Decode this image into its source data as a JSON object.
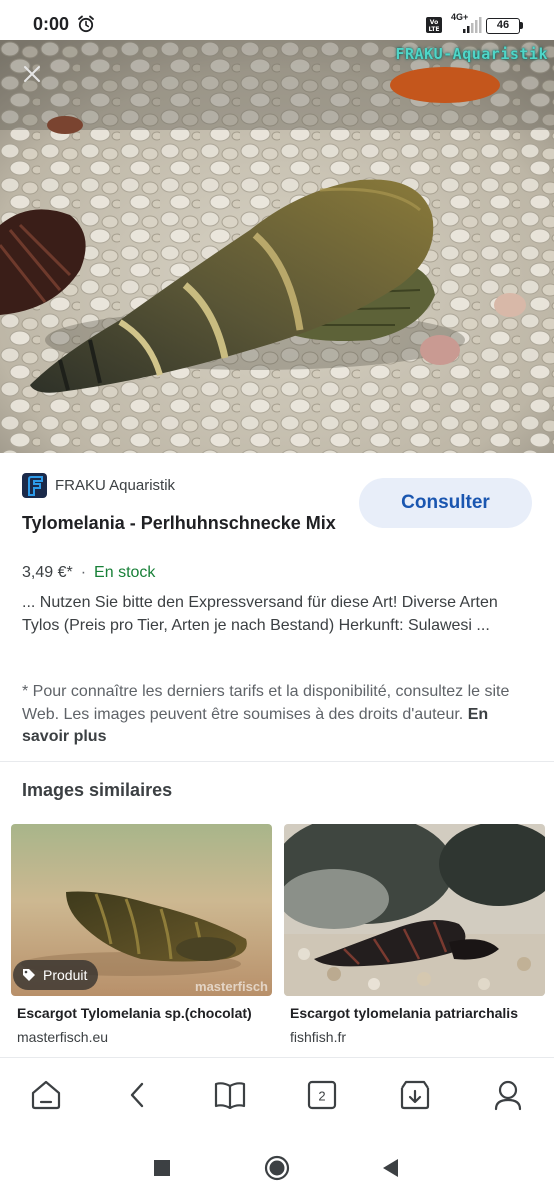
{
  "status_bar": {
    "time": "0:00",
    "network": "4G+",
    "volte": "VoLTE",
    "battery": "46",
    "icons": [
      "alarm-icon",
      "volte-icon",
      "signal-icon",
      "battery-icon"
    ]
  },
  "hero": {
    "watermark": "FRAKU-Aquaristik",
    "close_icon": "close-icon"
  },
  "result": {
    "source_name": "FRAKU Aquaristik",
    "visit_label": "Consulter",
    "title": "Tylomelania - Perlhuhnschnecke Mix",
    "price": "3,49 €*",
    "separator": "·",
    "stock": "En stock",
    "description": "... Nutzen Sie bitte den Expressversand für diese Art! Diverse Arten Tylos (Preis pro Tier, Arten je nach Bestand) Herkunft: Sulawesi ...",
    "disclaimer": "* Pour connaître les derniers tarifs et la disponibilité, consultez le site Web. Les images peuvent être soumises à des droits d'auteur.",
    "learn_more": "En savoir plus"
  },
  "similar": {
    "heading": "Images similaires",
    "items": [
      {
        "badge": "Produit",
        "watermark": "masterfisch",
        "title": "Escargot Tylomelania sp.(chocolat)",
        "source": "masterfisch.eu"
      },
      {
        "title": "Escargot tylomelania patriarchalis",
        "source": "fishfish.fr"
      }
    ]
  },
  "toolbar": {
    "tabs_count": "2",
    "icons": [
      "home-icon",
      "back-icon",
      "bookmarks-icon",
      "tabs-icon",
      "downloads-icon",
      "profile-icon"
    ]
  },
  "colors": {
    "accent": "#1a56b0",
    "button_bg": "#e8eef9",
    "stock_green": "#188038",
    "watermark": "#4fd6c8"
  }
}
